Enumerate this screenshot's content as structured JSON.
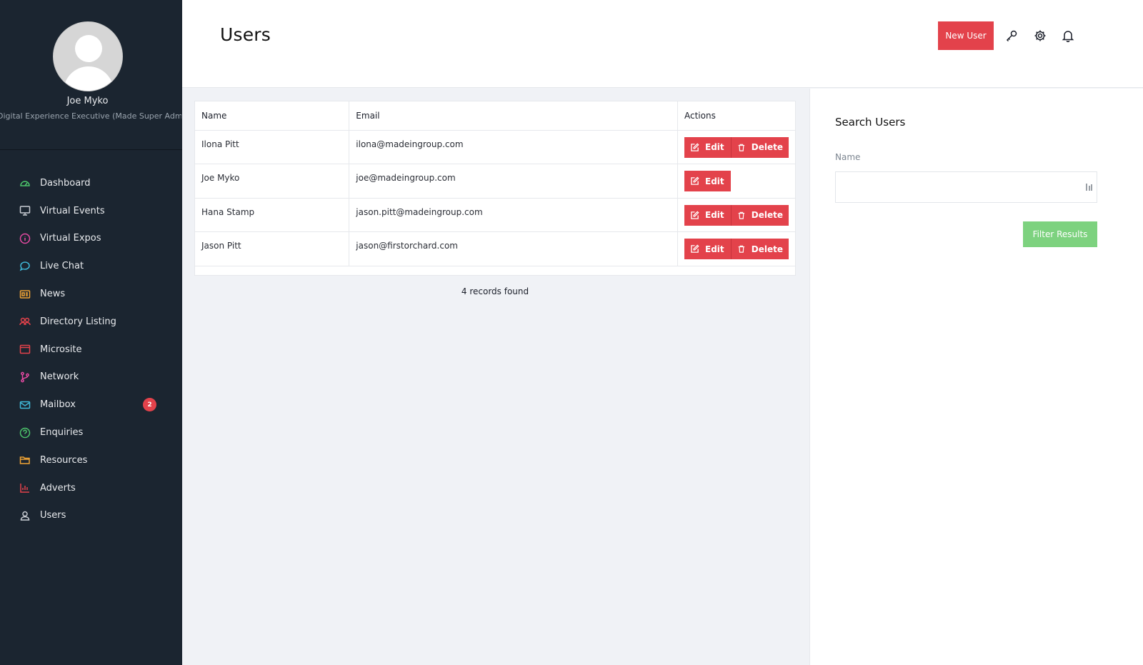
{
  "profile": {
    "name": "Joe Myko",
    "role": "Digital Experience Executive (Made Super Admin)"
  },
  "sidebar": {
    "items": [
      {
        "label": "Dashboard",
        "icon": "dashboard-icon",
        "color": "#4cc36b"
      },
      {
        "label": "Virtual Events",
        "icon": "monitor-icon",
        "color": "#c8ccd2"
      },
      {
        "label": "Virtual Expos",
        "icon": "info-icon",
        "color": "#e44aa2"
      },
      {
        "label": "Live Chat",
        "icon": "chat-icon",
        "color": "#3fb7d6"
      },
      {
        "label": "News",
        "icon": "newspaper-icon",
        "color": "#f0a334"
      },
      {
        "label": "Directory Listing",
        "icon": "users-group-icon",
        "color": "#e3424b"
      },
      {
        "label": "Microsite",
        "icon": "browser-icon",
        "color": "#e3424b"
      },
      {
        "label": "Network",
        "icon": "git-branch-icon",
        "color": "#e44aa2"
      },
      {
        "label": "Mailbox",
        "icon": "mail-icon",
        "color": "#3fb7d6",
        "badge": "2"
      },
      {
        "label": "Enquiries",
        "icon": "help-circle-icon",
        "color": "#4cc36b"
      },
      {
        "label": "Resources",
        "icon": "folder-icon",
        "color": "#f0a334"
      },
      {
        "label": "Adverts",
        "icon": "bar-chart-icon",
        "color": "#e3424b"
      },
      {
        "label": "Users",
        "icon": "user-icon",
        "color": "#c8ccd2"
      }
    ]
  },
  "header": {
    "title": "Users",
    "new_user_label": "New User"
  },
  "table": {
    "headers": {
      "name": "Name",
      "email": "Email",
      "actions": "Actions"
    },
    "rows": [
      {
        "name": "Ilona Pitt",
        "email": "ilona@madeingroup.com",
        "edit": "Edit",
        "delete": "Delete"
      },
      {
        "name": "Joe Myko",
        "email": "joe@madeingroup.com",
        "edit": "Edit"
      },
      {
        "name": "Hana Stamp",
        "email": "jason.pitt@madeingroup.com",
        "edit": "Edit",
        "delete": "Delete"
      },
      {
        "name": "Jason Pitt",
        "email": "jason@firstorchard.com",
        "edit": "Edit",
        "delete": "Delete"
      }
    ],
    "records_text": "4 records found"
  },
  "search": {
    "title": "Search Users",
    "name_label": "Name",
    "name_value": "",
    "filter_label": "Filter Results"
  },
  "colors": {
    "accent_red": "#e3424b",
    "filter_green": "#7dd27f",
    "sidebar_bg": "#1b2530"
  }
}
